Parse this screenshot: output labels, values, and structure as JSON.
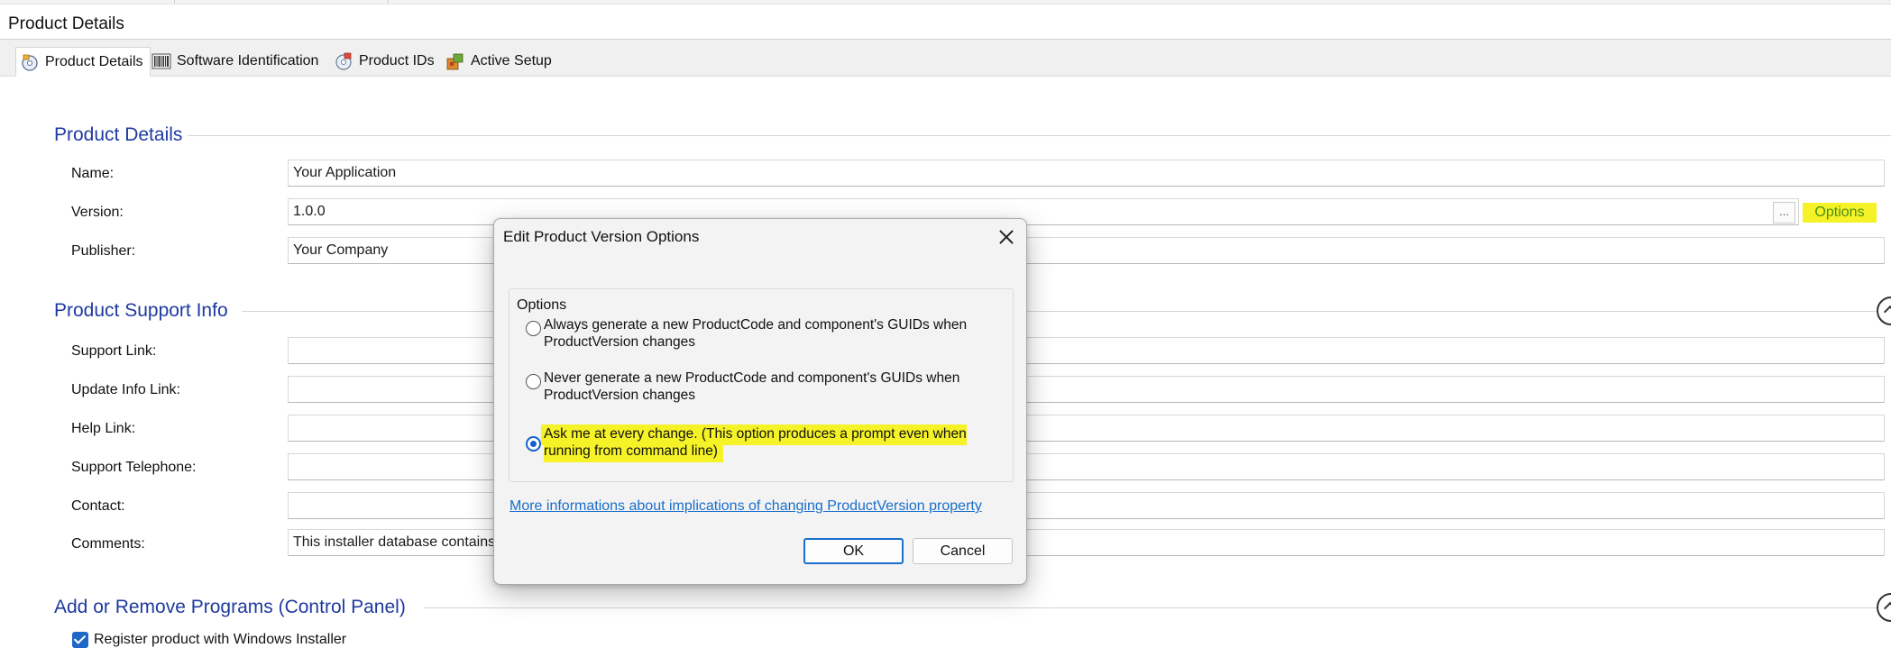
{
  "page_title": "Product Details",
  "tabs": [
    {
      "label": "Product Details",
      "icon": "product-details-icon",
      "active": true
    },
    {
      "label": "Software Identification",
      "icon": "barcode-icon",
      "active": false
    },
    {
      "label": "Product IDs",
      "icon": "product-ids-icon",
      "active": false
    },
    {
      "label": "Active Setup",
      "icon": "active-setup-icon",
      "active": false
    }
  ],
  "sections": {
    "product_details": {
      "title": "Product Details",
      "name_label": "Name:",
      "name_value": "Your Application",
      "version_label": "Version:",
      "version_value": "1.0.0",
      "browse_label": "...",
      "options_label": "Options",
      "publisher_label": "Publisher:",
      "publisher_value": "Your Company"
    },
    "support": {
      "title": "Product Support Info",
      "support_link_label": "Support Link:",
      "update_info_label": "Update Info Link:",
      "help_link_label": "Help Link:",
      "telephone_label": "Support Telephone:",
      "contact_label": "Contact:",
      "comments_label": "Comments:",
      "comments_value": "This installer database contains"
    },
    "arp": {
      "title": "Add or Remove Programs (Control Panel)",
      "register_label": "Register product with Windows Installer",
      "register_checked": true
    }
  },
  "dialog": {
    "title": "Edit Product Version Options",
    "group_label": "Options",
    "options": [
      {
        "text": "Always generate a new ProductCode and component's GUIDs when ProductVersion changes",
        "selected": false
      },
      {
        "text": "Never generate a new ProductCode and component's GUIDs when ProductVersion changes",
        "selected": false
      },
      {
        "text": "Ask me at every change. (This option produces a prompt even when running from command line)",
        "selected": true
      }
    ],
    "link": "More informations about implications of changing ProductVersion property",
    "ok_label": "OK",
    "cancel_label": "Cancel"
  },
  "colors": {
    "section_title": "#1f3aa0",
    "highlight": "#f5f227",
    "accent": "#1561c9"
  }
}
